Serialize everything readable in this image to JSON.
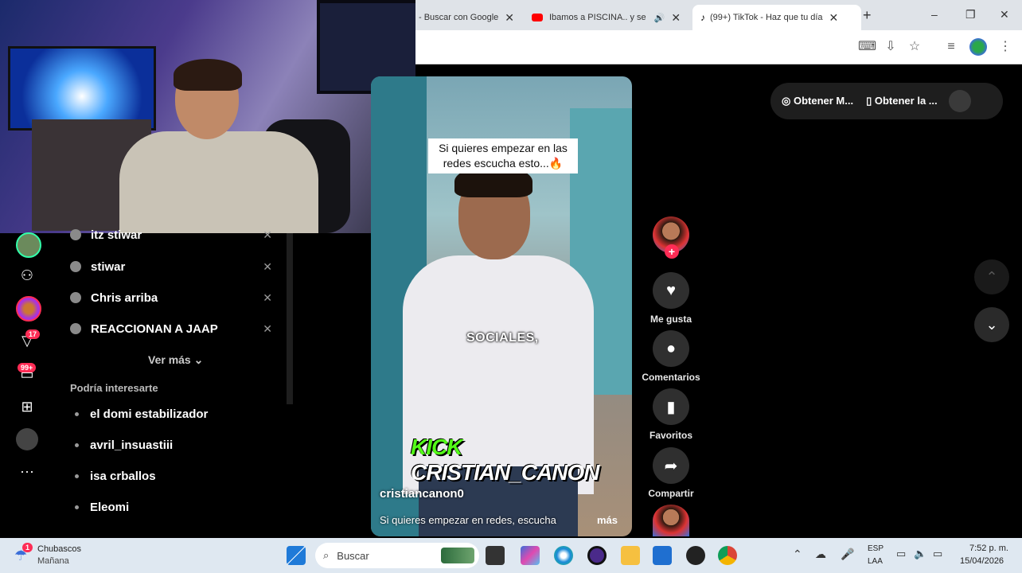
{
  "browser": {
    "tabs": [
      {
        "title": "- Buscar con Google",
        "close": "✕"
      },
      {
        "title": "Ibamos a PISCINA.. y se",
        "close": "✕"
      },
      {
        "title": "(99+) TikTok - Haz que tu día",
        "close": "✕"
      }
    ],
    "new_tab": "+",
    "window_controls": {
      "minimize": "–",
      "restore": "❐",
      "close": "✕"
    }
  },
  "sidebar": {
    "history": [
      {
        "label": "itz stiwar",
        "remove": "✕"
      },
      {
        "label": "stiwar",
        "remove": "✕"
      },
      {
        "label": "Chris arriba",
        "remove": "✕"
      },
      {
        "label": "REACCIONAN A JAAP",
        "remove": "✕"
      }
    ],
    "see_more": "Ver más",
    "suggestions_title": "Podría interesarte",
    "suggestions": [
      "el domi estabilizador",
      "avril_insuastiii",
      "isa crballos",
      "Eleomi"
    ],
    "rail": {
      "activity_badge": "17",
      "inbox_badge": "99+",
      "more": "···"
    }
  },
  "video": {
    "caption_overlay": "Si quieres empezar en las redes escucha esto...🔥",
    "subtitle": "SOCIALES,",
    "banner_prefix": "KICK",
    "banner_name": "CRISTIAN_CANON",
    "author": "cristiancanon0",
    "description": "Si quieres empezar en redes, escucha",
    "more": "más"
  },
  "actions": {
    "like": "Me gusta",
    "comments": "Comentarios",
    "favorites": "Favoritos",
    "share": "Compartir"
  },
  "top_pill": {
    "get_app": "Obtener M...",
    "get_mobile": "Obtener la ..."
  },
  "taskbar": {
    "weather_badge": "1",
    "weather_title": "Chubascos",
    "weather_sub": "Mañana",
    "search_placeholder": "Buscar",
    "lang_top": "ESP",
    "lang_bottom": "LAA",
    "time": "7:52 p. m.",
    "date": "15/04/2026"
  },
  "colors": {
    "tiktok_red": "#fe2c55",
    "kick_green": "#53fc18"
  }
}
